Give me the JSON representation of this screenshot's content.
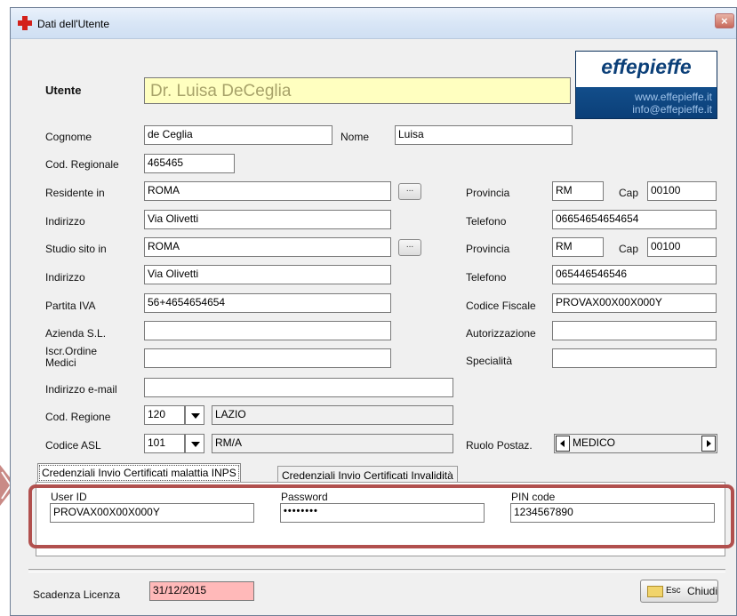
{
  "window": {
    "title": "Dati dell'Utente"
  },
  "logo": {
    "brand": "effepieffe",
    "site": "www.effepieffe.it",
    "email": "info@effepieffe.it"
  },
  "utente": {
    "label": "Utente",
    "value": "Dr. Luisa DeCeglia"
  },
  "cognome": {
    "label": "Cognome",
    "value": "de Ceglia"
  },
  "nome": {
    "label": "Nome",
    "value": "Luisa"
  },
  "cod_regionale": {
    "label": "Cod. Regionale",
    "value": "465465"
  },
  "residente": {
    "label": "Residente in",
    "value": "ROMA",
    "button": "..."
  },
  "provincia1": {
    "label": "Provincia",
    "value": "RM"
  },
  "cap1": {
    "label": "Cap",
    "value": "00100"
  },
  "indirizzo1": {
    "label": "Indirizzo",
    "value": "Via Olivetti"
  },
  "telefono1": {
    "label": "Telefono",
    "value": "06654654654654"
  },
  "studio": {
    "label": "Studio sito in",
    "value": "ROMA",
    "button": "..."
  },
  "provincia2": {
    "label": "Provincia",
    "value": "RM"
  },
  "cap2": {
    "label": "Cap",
    "value": "00100"
  },
  "indirizzo2": {
    "label": "Indirizzo",
    "value": "Via Olivetti"
  },
  "telefono2": {
    "label": "Telefono",
    "value": "065446546546"
  },
  "partita_iva": {
    "label": "Partita IVA",
    "value": "56+4654654654"
  },
  "codice_fiscale": {
    "label": "Codice Fiscale",
    "value": "PROVAX00X00X000Y"
  },
  "azienda": {
    "label": "Azienda S.L.",
    "value": ""
  },
  "autorizzazione": {
    "label": "Autorizzazione",
    "value": ""
  },
  "iscr_ordine": {
    "label_line1": "Iscr.Ordine",
    "label_line2": "Medici",
    "value": ""
  },
  "specialita": {
    "label": "Specialità",
    "value": ""
  },
  "email": {
    "label": "Indirizzo e-mail",
    "value": ""
  },
  "cod_regione": {
    "label": "Cod. Regione",
    "code": "120",
    "name": "LAZIO"
  },
  "codice_asl": {
    "label": "Codice ASL",
    "code": "101",
    "name": "RM/A"
  },
  "ruolo": {
    "label": "Ruolo Postaz.",
    "value": "MEDICO"
  },
  "tabs": [
    {
      "label": "Credenziali Invio Certificati malattia INPS",
      "active": true
    },
    {
      "label": "Credenziali Invio Certificati Invalidità",
      "active": false
    }
  ],
  "credentials": {
    "user_id": {
      "label": "User ID",
      "value": "PROVAX00X00X000Y"
    },
    "password": {
      "label": "Password",
      "value": "••••••••"
    },
    "pin": {
      "label": "PIN code",
      "value": "1234567890"
    }
  },
  "scadenza": {
    "label": "Scadenza Licenza",
    "value": "31/12/2015"
  },
  "chiudi": {
    "hotkey": "Esc",
    "label": "Chiudi"
  },
  "colors": {
    "highlight": "#b1504e",
    "utente_bg": "#ffffc0",
    "scadenza_bg": "#ffb9b9",
    "logo_blue": "#0b3f78"
  }
}
